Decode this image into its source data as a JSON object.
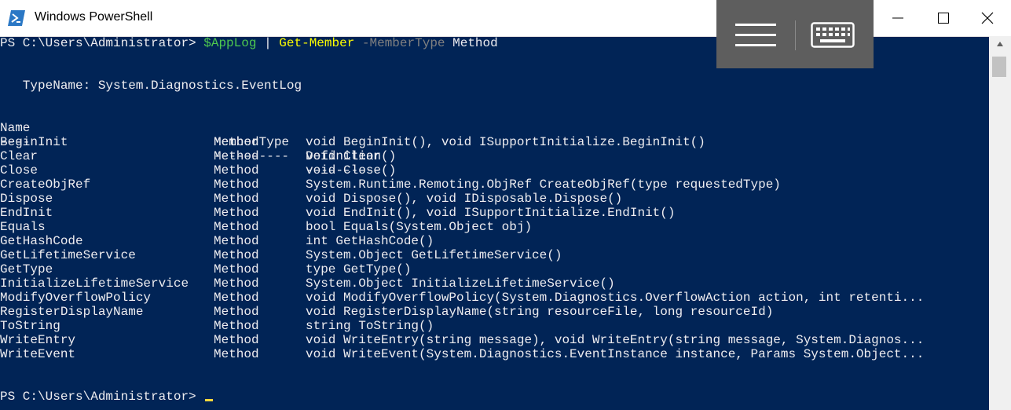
{
  "window": {
    "title": "Windows PowerShell"
  },
  "prompt": "PS C:\\Users\\Administrator> ",
  "command": {
    "variable": "$AppLog",
    "pipe": " | ",
    "cmdlet": "Get-Member",
    "parameter": " -MemberType",
    "argument": " Method"
  },
  "type_name_line": "   TypeName: System.Diagnostics.EventLog",
  "table": {
    "headers": {
      "name": "Name",
      "member_type": "MemberType",
      "definition": "Definition"
    },
    "separators": {
      "name": "----",
      "member_type": "----------",
      "definition": "----------"
    },
    "rows": [
      {
        "name": "BeginInit",
        "member_type": "Method",
        "definition": "void BeginInit(), void ISupportInitialize.BeginInit()"
      },
      {
        "name": "Clear",
        "member_type": "Method",
        "definition": "void Clear()"
      },
      {
        "name": "Close",
        "member_type": "Method",
        "definition": "void Close()"
      },
      {
        "name": "CreateObjRef",
        "member_type": "Method",
        "definition": "System.Runtime.Remoting.ObjRef CreateObjRef(type requestedType)"
      },
      {
        "name": "Dispose",
        "member_type": "Method",
        "definition": "void Dispose(), void IDisposable.Dispose()"
      },
      {
        "name": "EndInit",
        "member_type": "Method",
        "definition": "void EndInit(), void ISupportInitialize.EndInit()"
      },
      {
        "name": "Equals",
        "member_type": "Method",
        "definition": "bool Equals(System.Object obj)"
      },
      {
        "name": "GetHashCode",
        "member_type": "Method",
        "definition": "int GetHashCode()"
      },
      {
        "name": "GetLifetimeService",
        "member_type": "Method",
        "definition": "System.Object GetLifetimeService()"
      },
      {
        "name": "GetType",
        "member_type": "Method",
        "definition": "type GetType()"
      },
      {
        "name": "InitializeLifetimeService",
        "member_type": "Method",
        "definition": "System.Object InitializeLifetimeService()"
      },
      {
        "name": "ModifyOverflowPolicy",
        "member_type": "Method",
        "definition": "void ModifyOverflowPolicy(System.Diagnostics.OverflowAction action, int retenti..."
      },
      {
        "name": "RegisterDisplayName",
        "member_type": "Method",
        "definition": "void RegisterDisplayName(string resourceFile, long resourceId)"
      },
      {
        "name": "ToString",
        "member_type": "Method",
        "definition": "string ToString()"
      },
      {
        "name": "WriteEntry",
        "member_type": "Method",
        "definition": "void WriteEntry(string message), void WriteEntry(string message, System.Diagnos..."
      },
      {
        "name": "WriteEvent",
        "member_type": "Method",
        "definition": "void WriteEvent(System.Diagnostics.EventInstance instance, Params System.Object..."
      }
    ]
  },
  "colors": {
    "console_background": "#012456",
    "console_text": "#eeedf0",
    "variable": "#4ec94e",
    "cmdlet": "#ffff00",
    "parameter": "#808080",
    "cursor": "#f8d83c",
    "overlay": "#5e5e5e"
  },
  "icons": {
    "app": "powershell-icon",
    "minimize": "minimize-icon",
    "maximize": "maximize-icon",
    "close": "close-icon",
    "menu": "hamburger-menu-icon",
    "keyboard": "keyboard-icon"
  }
}
